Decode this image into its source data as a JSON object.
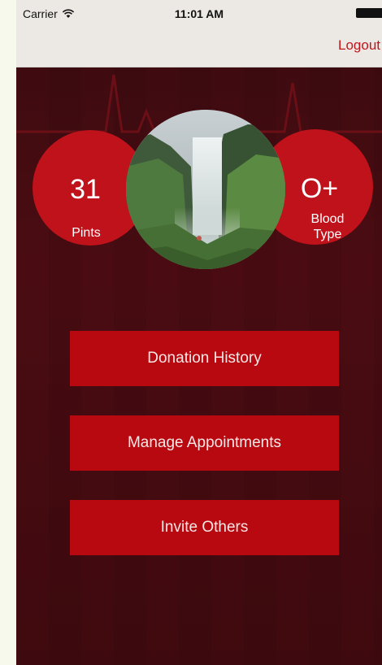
{
  "status_bar": {
    "carrier": "Carrier",
    "time": "11:01 AM",
    "icons": [
      "wifi-icon",
      "battery-icon"
    ]
  },
  "nav": {
    "logout_label": "Logout"
  },
  "stats": {
    "pints": {
      "value": "31",
      "label": "Pints"
    },
    "blood_type": {
      "value": "O+",
      "label_line1": "Blood",
      "label_line2": "Type"
    }
  },
  "photo": {
    "icon": "waterfall-photo"
  },
  "buttons": {
    "donation_history": "Donation History",
    "manage_appointments": "Manage Appointments",
    "invite_others": "Invite Others"
  },
  "colors": {
    "accent_red": "#c0121b",
    "button_red": "#b80910",
    "background_dark": "#3f0a0f",
    "nav_bar": "#ece9e4",
    "logout_text": "#c2151b"
  }
}
